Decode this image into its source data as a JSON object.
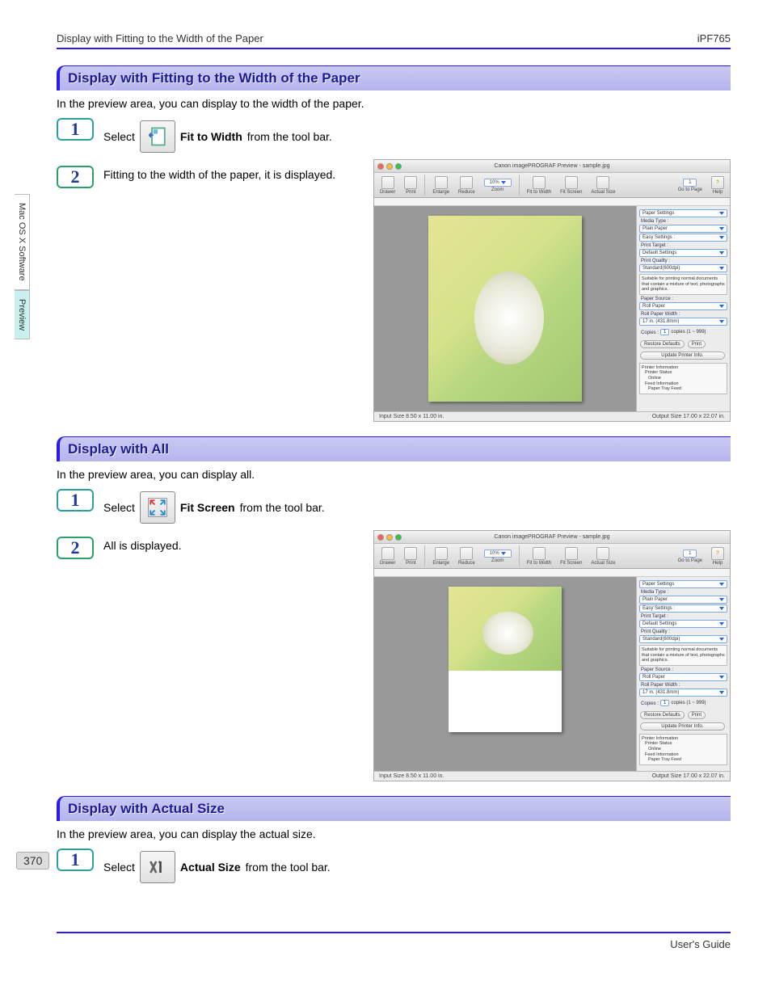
{
  "header": {
    "left": "Display with Fitting to the Width of the Paper",
    "right": "iPF765"
  },
  "sidebar": {
    "tab1": "Mac OS X Software",
    "tab2": "Preview"
  },
  "section1": {
    "title": "Display with Fitting to the Width of the Paper",
    "intro": "In the preview area, you can display to the width of the paper.",
    "step1_a": "Select",
    "step1_b": "Fit to Width",
    "step1_c": " from the tool bar.",
    "step2": "Fitting to the width of the paper, it is displayed."
  },
  "section2": {
    "title": "Display with All",
    "intro": "In the preview area, you can display all.",
    "step1_a": "Select",
    "step1_b": "Fit Screen",
    "step1_c": " from the tool bar.",
    "step2": "All is displayed."
  },
  "section3": {
    "title": "Display with Actual Size",
    "intro": "In the preview area, you can display the actual size.",
    "step1_a": "Select",
    "step1_b": "Actual Size",
    "step1_c": " from the tool bar."
  },
  "screenshot": {
    "title": "Canon imagePROGRAF Preview - sample.jpg",
    "toolbar": {
      "drawer": "Drawer",
      "print": "Print",
      "enlarge": "Enlarge",
      "reduce": "Reduce",
      "zoom": "Zoom",
      "zoom_val": "10%",
      "fit_width": "Fit to Width",
      "fit_screen": "Fit Screen",
      "actual": "Actual Size",
      "goto": "Go to Page",
      "page": "1",
      "help": "Help"
    },
    "panel": {
      "paper_settings": "Paper Settings",
      "media_type": "Media Type :",
      "media_type_v": "Plain Paper",
      "easy_settings": "Easy Settings :",
      "print_target": "Print Target :",
      "print_target_v": "Default Settings",
      "print_quality": "Print Quality :",
      "print_quality_v": "Standard(600dpi)",
      "desc": "Suitable for printing normal documents that contain a mixture of text, photographs and graphics.",
      "paper_source": "Paper Source :",
      "paper_source_v": "Roll Paper",
      "roll_width": "Roll Paper Width :",
      "roll_width_v": "17 in. (431.8mm)",
      "copies": "Copies :",
      "copies_v": "1",
      "copies_range": "copies (1 ~ 999)",
      "restore": "Restore Defaults",
      "print_btn": "Print",
      "update": "Update Printer Info.",
      "info_h": "Printer Information",
      "info_l1": "Printer Status",
      "info_l2": "Online",
      "info_l3": "Feed Information",
      "info_l4": "Paper Tray Feed"
    },
    "status": {
      "input": "Input Size 8.50 x 11.00 in.",
      "output": "Output Size 17.00 x 22.07 in."
    }
  },
  "footer": {
    "guide": "User's Guide",
    "page": "370"
  }
}
